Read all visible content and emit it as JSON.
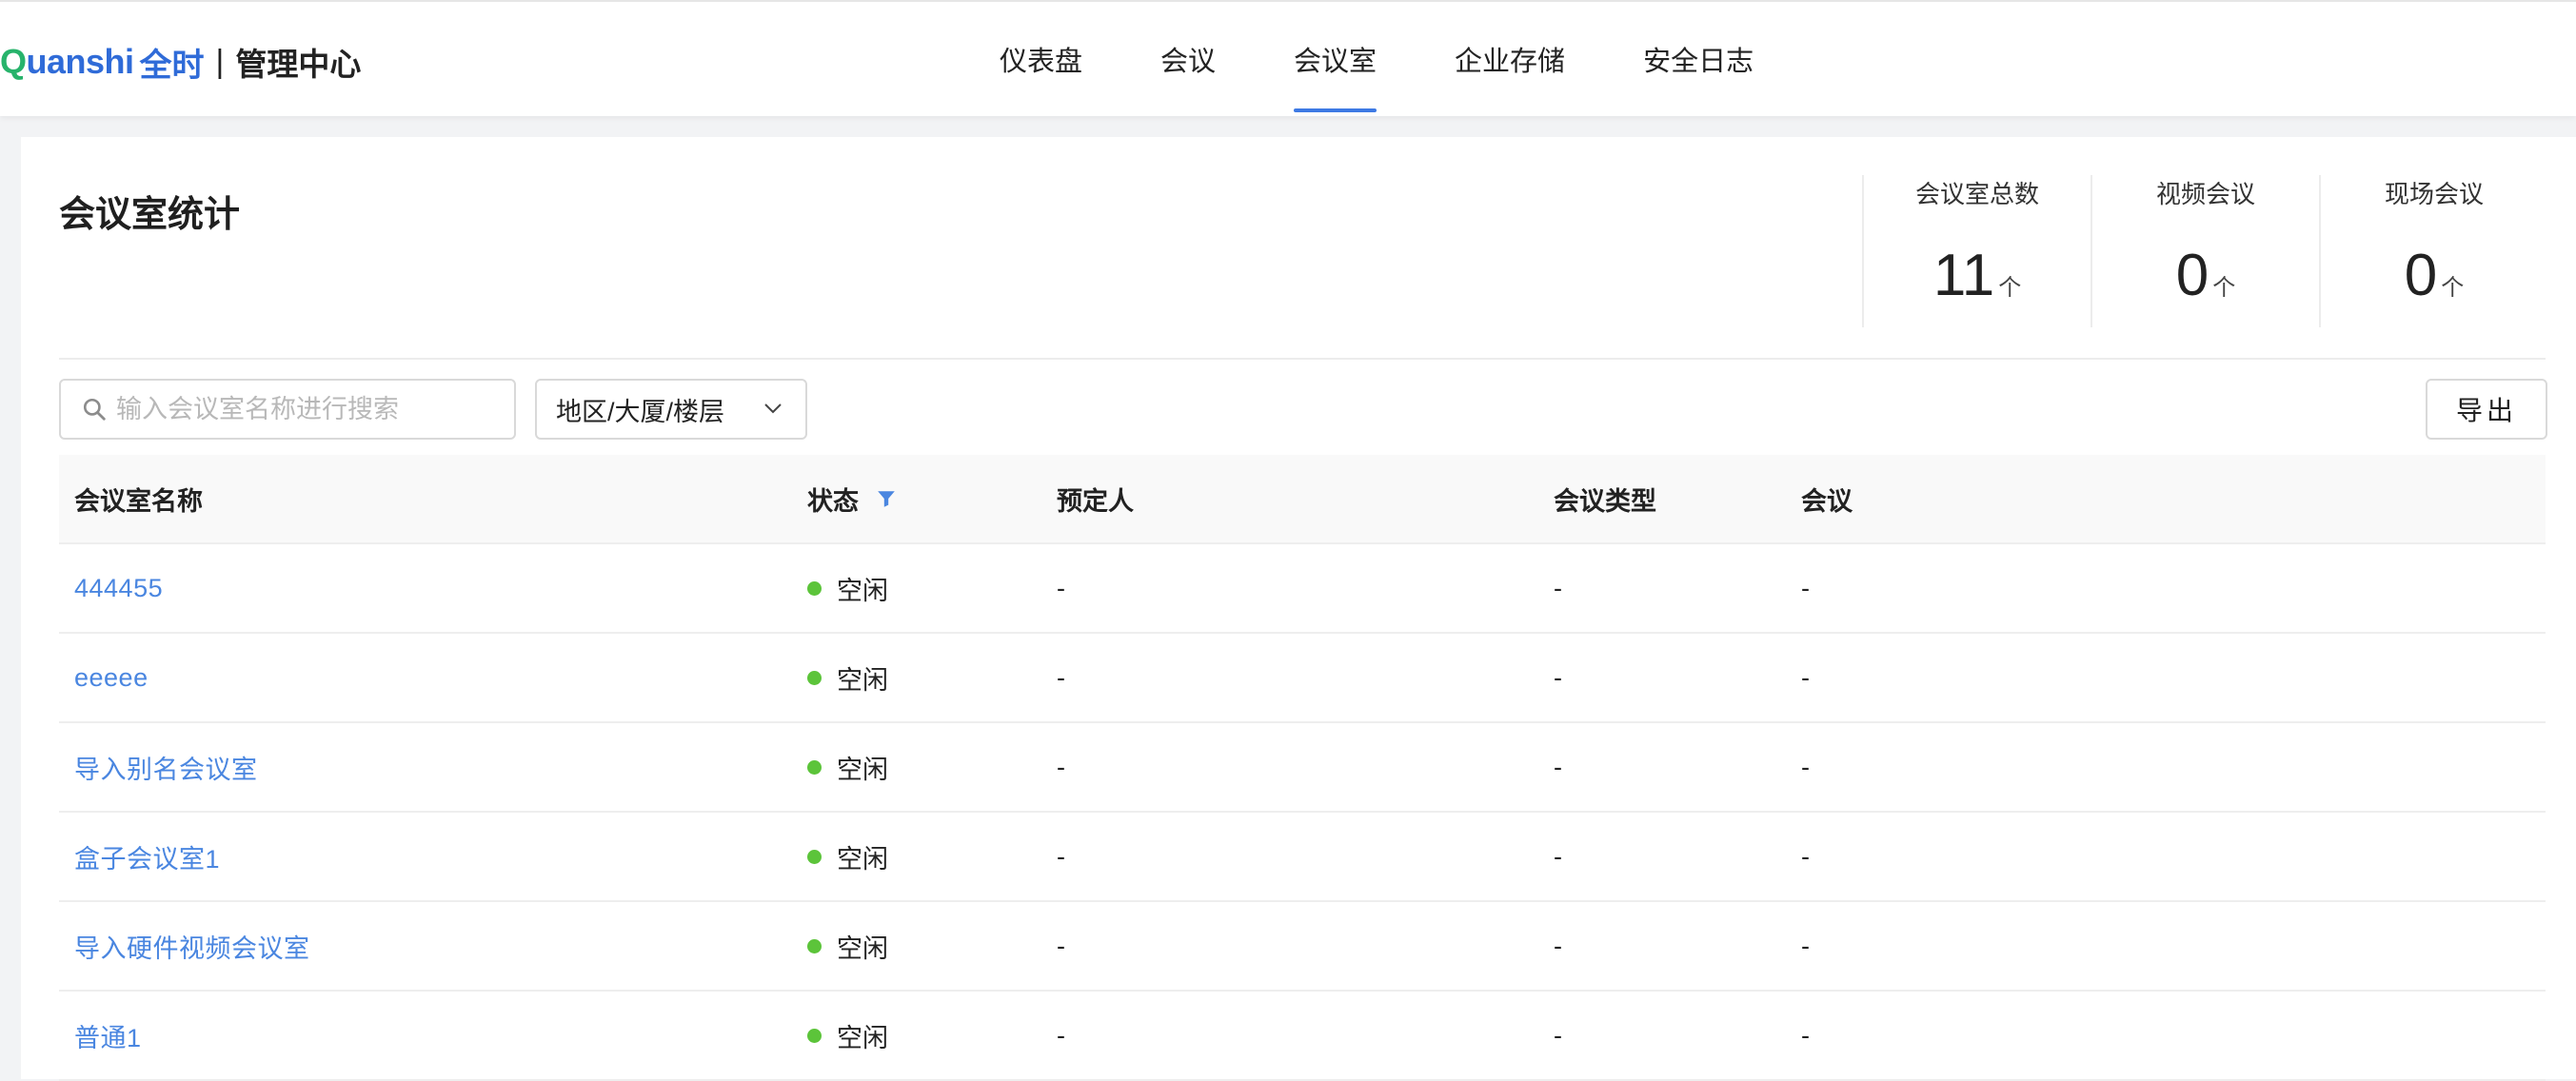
{
  "brand": {
    "logo_start": "Q",
    "logo_rest": "uanshi",
    "cn_name": "全时",
    "separator": "|",
    "title": "管理中心"
  },
  "nav": [
    {
      "label": "仪表盘",
      "active": false
    },
    {
      "label": "会议",
      "active": false
    },
    {
      "label": "会议室",
      "active": true
    },
    {
      "label": "企业存储",
      "active": false
    },
    {
      "label": "安全日志",
      "active": false
    }
  ],
  "page": {
    "title": "会议室统计"
  },
  "stats": [
    {
      "label": "会议室总数",
      "value": "11",
      "unit": "个"
    },
    {
      "label": "视频会议",
      "value": "0",
      "unit": "个"
    },
    {
      "label": "现场会议",
      "value": "0",
      "unit": "个"
    }
  ],
  "filters": {
    "search_placeholder": "输入会议室名称进行搜索",
    "search_value": "",
    "location_select": "地区/大厦/楼层",
    "export_label": "导出"
  },
  "table": {
    "columns": [
      "会议室名称",
      "状态",
      "预定人",
      "会议类型",
      "会议"
    ],
    "rows": [
      {
        "name": "444455",
        "status": "空闲",
        "booker": "-",
        "type": "-",
        "meeting": "-"
      },
      {
        "name": "eeeee",
        "status": "空闲",
        "booker": "-",
        "type": "-",
        "meeting": "-"
      },
      {
        "name": "导入别名会议室",
        "status": "空闲",
        "booker": "-",
        "type": "-",
        "meeting": "-"
      },
      {
        "name": "盒子会议室1",
        "status": "空闲",
        "booker": "-",
        "type": "-",
        "meeting": "-"
      },
      {
        "name": "导入硬件视频会议室",
        "status": "空闲",
        "booker": "-",
        "type": "-",
        "meeting": "-"
      },
      {
        "name": "普通1",
        "status": "空闲",
        "booker": "-",
        "type": "-",
        "meeting": "-"
      }
    ]
  },
  "colors": {
    "accent": "#3e7ae4",
    "link": "#4a86e0",
    "status_idle": "#5cc43a",
    "brand_green": "#27b36b",
    "brand_blue": "#2f6bd8"
  },
  "icons": {
    "search": "search-icon",
    "filter": "filter-icon",
    "dropdown": "chevron-down-icon"
  }
}
